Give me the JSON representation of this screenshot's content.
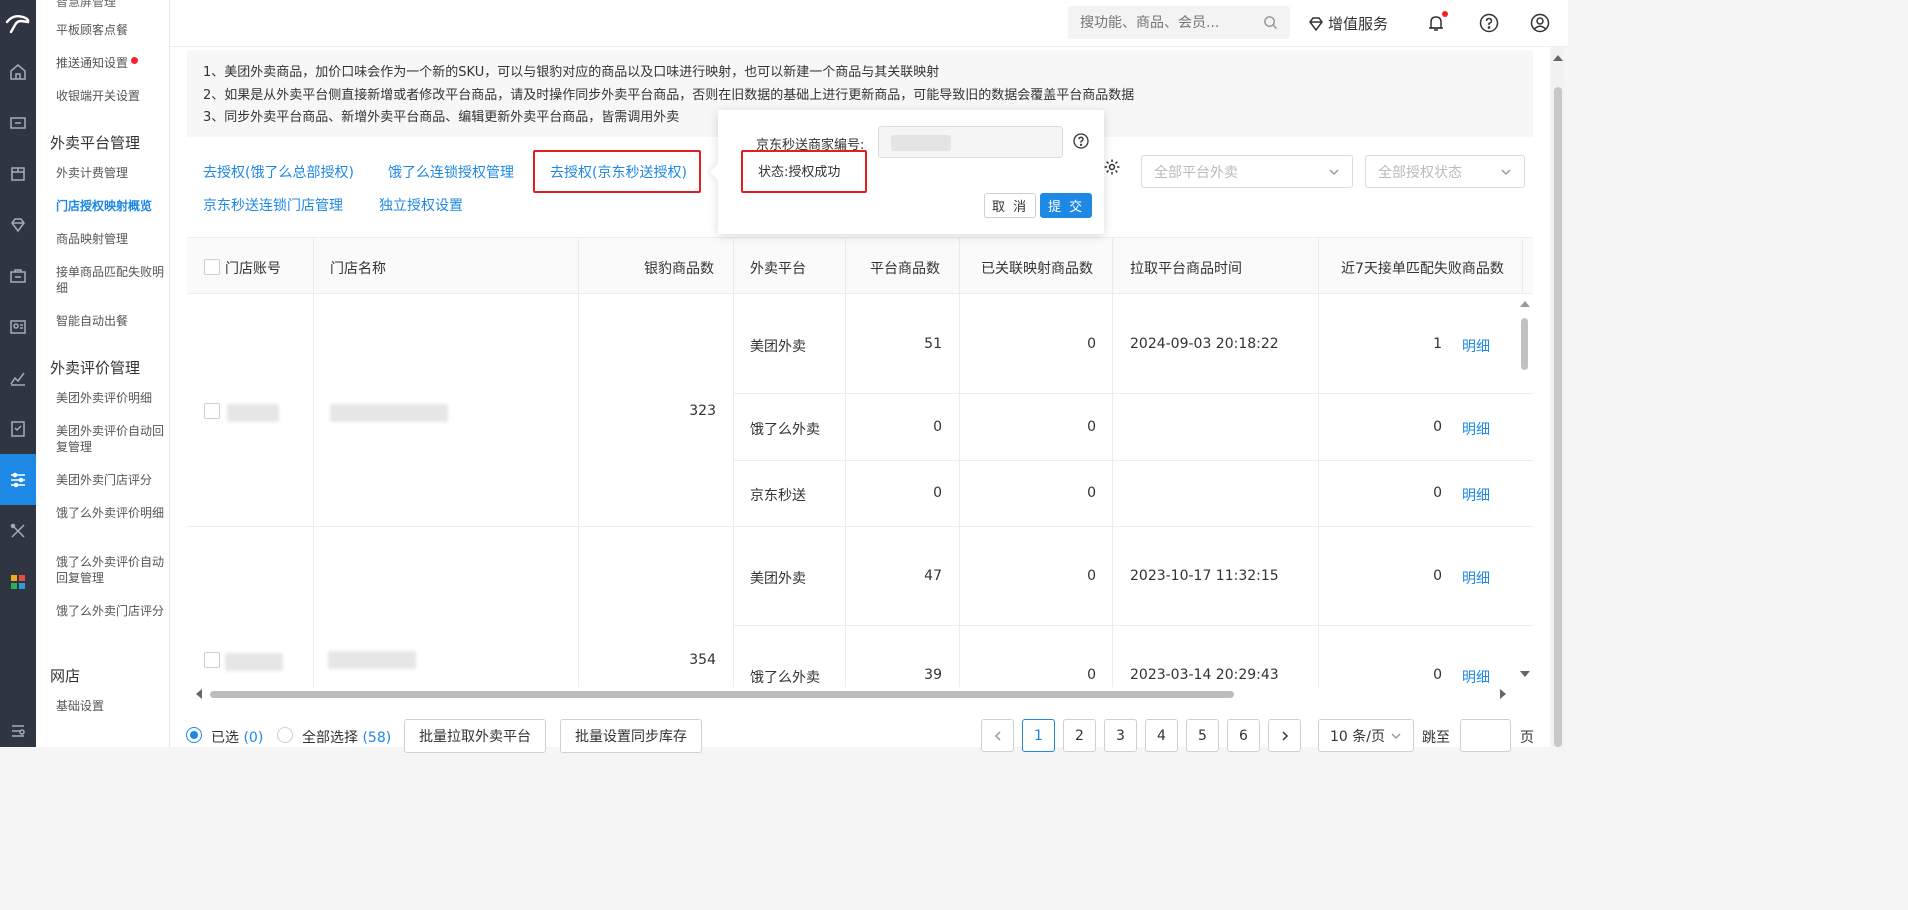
{
  "submenu": {
    "items_top": [
      "平板顾客点餐",
      "推送通知设置",
      "收银端开关设置"
    ],
    "group_takeout": "外卖平台管理",
    "takeout_items": [
      "外卖计费管理",
      "门店授权映射概览",
      "商品映射管理",
      "接单商品匹配失败明细",
      "智能自动出餐"
    ],
    "group_review": "外卖评价管理",
    "review_items": [
      "美团外卖评价明细",
      "美团外卖评价自动回复管理",
      "美团外卖门店评分",
      "饿了么外卖评价明细",
      "饿了么外卖评价自动回复管理",
      "饿了么外卖门店评分"
    ],
    "group_web": "网店",
    "web_items": [
      "基础设置"
    ]
  },
  "topbar": {
    "search_placeholder": "搜功能、商品、会员...",
    "vas_label": "增值服务"
  },
  "notice": [
    "1、美团外卖商品，加价口味会作为一个新的SKU，可以与银豹对应的商品以及口味进行映射，也可以新建一个商品与其关联映射",
    "2、如果是从外卖平台侧直接新增或者修改平台商品，请及时操作同步外卖平台商品，否则在旧数据的基础上进行更新商品，可能导致旧的数据会覆盖平台商品数据",
    "3、同步外卖平台商品、新增外卖平台商品、编辑更新外卖平台商品，皆需调用外卖"
  ],
  "links": {
    "eleme_all": "去授权(饿了么总部授权)",
    "eleme_chain": "饿了么连锁授权管理",
    "jd_auth": "去授权(京东秒送授权)",
    "jd_chain": "京东秒送连锁门店管理",
    "independent": "独立授权设置"
  },
  "filters": {
    "platform": "全部平台外卖",
    "auth_status": "全部授权状态"
  },
  "popover": {
    "merchant_label": "京东秒送商家编号:",
    "status": "状态:授权成功",
    "cancel": "取 消",
    "submit": "提 交"
  },
  "table": {
    "headers": [
      "门店账号",
      "门店名称",
      "银豹商品数",
      "外卖平台",
      "平台商品数",
      "已关联映射商品数",
      "拉取平台商品时间",
      "近7天接单匹配失败商品数"
    ],
    "detail_label": "明细",
    "stores": [
      {
        "product_count": "323",
        "rows": [
          {
            "platform": "美团外卖",
            "platform_count": "51",
            "mapped": "0",
            "time": "2024-09-03 20:18:22",
            "fail": "1"
          },
          {
            "platform": "饿了么外卖",
            "platform_count": "0",
            "mapped": "0",
            "time": "",
            "fail": "0"
          },
          {
            "platform": "京东秒送",
            "platform_count": "0",
            "mapped": "0",
            "time": "",
            "fail": "0"
          }
        ]
      },
      {
        "product_count": "354",
        "rows": [
          {
            "platform": "美团外卖",
            "platform_count": "47",
            "mapped": "0",
            "time": "2023-10-17 11:32:15",
            "fail": "0"
          },
          {
            "platform": "饿了么外卖",
            "platform_count": "39",
            "mapped": "0",
            "time": "2023-03-14 20:29:43",
            "fail": "0"
          }
        ]
      }
    ]
  },
  "footer": {
    "selected_label": "已选",
    "selected_count": "(0)",
    "select_all_label": "全部选择",
    "select_all_count": "(58)",
    "batch_pull": "批量拉取外卖平台",
    "batch_stock": "批量设置同步库存",
    "pages": [
      "1",
      "2",
      "3",
      "4",
      "5",
      "6"
    ],
    "current_page": "1",
    "page_size": "10 条/页",
    "jump_label": "跳至",
    "page_unit": "页"
  },
  "colors": {
    "accent": "#1e88e5",
    "highlight_box": "#e02020",
    "rail": "#2f3541"
  }
}
